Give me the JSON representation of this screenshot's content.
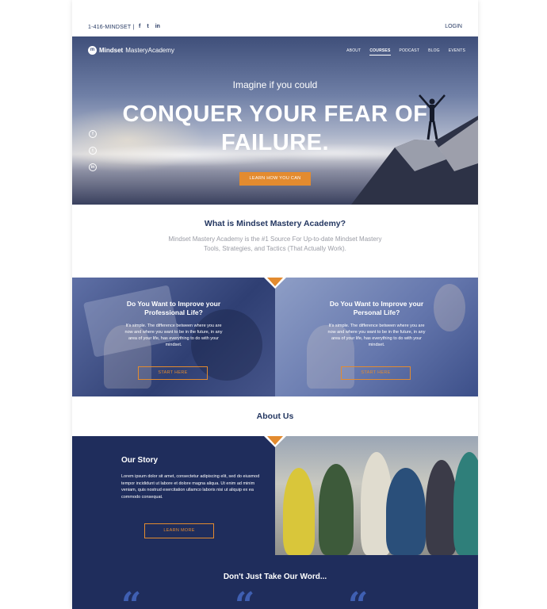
{
  "topbar": {
    "phone": "1-416-MINDSET |",
    "social": [
      "f",
      "t",
      "in"
    ],
    "login": "LOGIN"
  },
  "brand": {
    "logo_mark": "m",
    "name_bold": "Mindset",
    "name_rest": "MasteryAcademy"
  },
  "nav": {
    "items": [
      "ABOUT",
      "COURSES",
      "PODCAST",
      "BLOG",
      "EVENTS"
    ],
    "active": "COURSES"
  },
  "hero": {
    "subtitle": "Imagine if you could",
    "title": "CONQUER YOUR FEAR OF FAILURE.",
    "cta": "LEARN HOW YOU CAN",
    "social": [
      "f",
      "t",
      "in"
    ]
  },
  "intro": {
    "title": "What is Mindset Mastery Academy?",
    "description": "Mindset Mastery Academy is the #1 Source For Up-to-date Mindset Mastery Tools, Strategies, and Tactics (That Actually Work)."
  },
  "panels": [
    {
      "title": "Do You Want to Improve your Professional Life?",
      "text": "It's simple. The difference between where you are now and where you want to be in the future, in any area of your life, has everything to do with your mindset.",
      "button": "START HERE"
    },
    {
      "title": "Do You Want to Improve your Personal Life?",
      "text": "It's simple. The difference between where you are now and where you want to be in the future, in any area of your life, has everything to do with your mindset.",
      "button": "START HERE"
    }
  ],
  "about": {
    "title": "About Us",
    "story_title": "Our Story",
    "story_text": "Lorem ipsum dolor sit amet, consectetur adipiscing elit, sed do eiusmod tempor incididunt ut labore et dolore magna aliqua. Ut enim ad minim veniam, quis nostrud exercitation ullamco laboris nisi ut aliquip ex ea commodo consequat.",
    "button": "LEARN MORE"
  },
  "testimonials": {
    "title": "Don't Just Take Our Word...",
    "quote_glyph": "“"
  },
  "colors": {
    "navy": "#1f2d5c",
    "accent": "#e38b2f",
    "heading": "#243761"
  }
}
